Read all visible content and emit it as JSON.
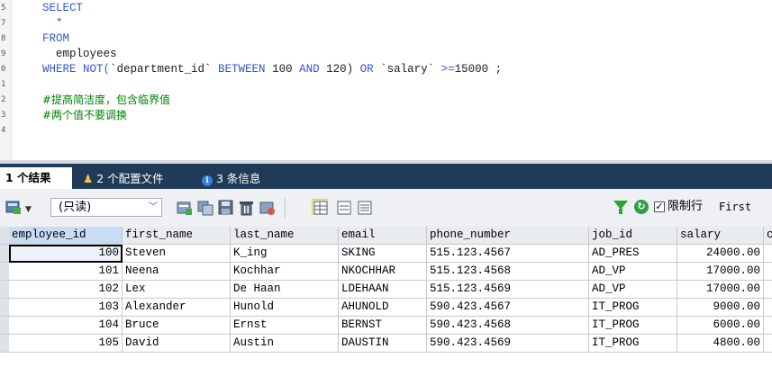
{
  "editor": {
    "line_numbers": [
      "5",
      "7",
      "8",
      "9",
      "0",
      "1",
      "2",
      "3",
      "4"
    ],
    "lines": [
      {
        "parts": [
          {
            "t": "SELECT",
            "c": "kw"
          }
        ]
      },
      {
        "parts": [
          {
            "t": "  *",
            "c": "op"
          }
        ]
      },
      {
        "parts": [
          {
            "t": "FROM",
            "c": "kw"
          }
        ]
      },
      {
        "parts": [
          {
            "t": "  employees",
            "c": "plain"
          }
        ]
      },
      {
        "parts": [
          {
            "t": "WHERE NOT(",
            "c": "kw"
          },
          {
            "t": "`department_id`",
            "c": "str"
          },
          {
            "t": " BETWEEN ",
            "c": "kw"
          },
          {
            "t": "100",
            "c": "num"
          },
          {
            "t": " AND ",
            "c": "kw"
          },
          {
            "t": "120) ",
            "c": "num"
          },
          {
            "t": "OR ",
            "c": "kw"
          },
          {
            "t": "`salary`",
            "c": "str"
          },
          {
            "t": " >=",
            "c": "kw"
          },
          {
            "t": "15000 ;",
            "c": "num"
          }
        ]
      },
      {
        "parts": [
          {
            "t": "",
            "c": "plain"
          }
        ]
      },
      {
        "parts": [
          {
            "t": "#提高简洁度，包含临界值",
            "c": "cmt"
          }
        ]
      },
      {
        "parts": [
          {
            "t": "#两个值不要调换",
            "c": "cmt"
          }
        ]
      },
      {
        "parts": [
          {
            "t": "",
            "c": "plain"
          }
        ]
      }
    ]
  },
  "tabs": [
    {
      "icon": "",
      "label": "1 个结果",
      "active": true
    },
    {
      "icon": "♟",
      "label": "2 个配置文件",
      "active": false
    },
    {
      "icon": "ℹ",
      "label": "3 条信息",
      "active": false
    }
  ],
  "toolbar": {
    "mode_select": "(只读)",
    "limit_checked": "✓",
    "limit_label": "限制行",
    "first_label": "First"
  },
  "grid": {
    "columns": [
      "employee_id",
      "first_name",
      "last_name",
      "email",
      "phone_number",
      "job_id",
      "salary",
      "c"
    ],
    "rows": [
      [
        "100",
        "Steven",
        "K_ing",
        "SKING",
        "515.123.4567",
        "AD_PRES",
        "24000.00",
        ""
      ],
      [
        "101",
        "Neena",
        "Kochhar",
        "NKOCHHAR",
        "515.123.4568",
        "AD_VP",
        "17000.00",
        ""
      ],
      [
        "102",
        "Lex",
        "De Haan",
        "LDEHAAN",
        "515.123.4569",
        "AD_VP",
        "17000.00",
        ""
      ],
      [
        "103",
        "Alexander",
        "Hunold",
        "AHUNOLD",
        "590.423.4567",
        "IT_PROG",
        "9000.00",
        ""
      ],
      [
        "104",
        "Bruce",
        "Ernst",
        "BERNST",
        "590.423.4568",
        "IT_PROG",
        "6000.00",
        ""
      ],
      [
        "105",
        "David",
        "Austin",
        "DAUSTIN",
        "590.423.4569",
        "IT_PROG",
        "4800.00",
        ""
      ]
    ]
  },
  "colors": {
    "keyword": "#3355cc",
    "comment": "#008000",
    "tab_bar": "#1f3b57",
    "header_selected": "#c8dcf3"
  }
}
